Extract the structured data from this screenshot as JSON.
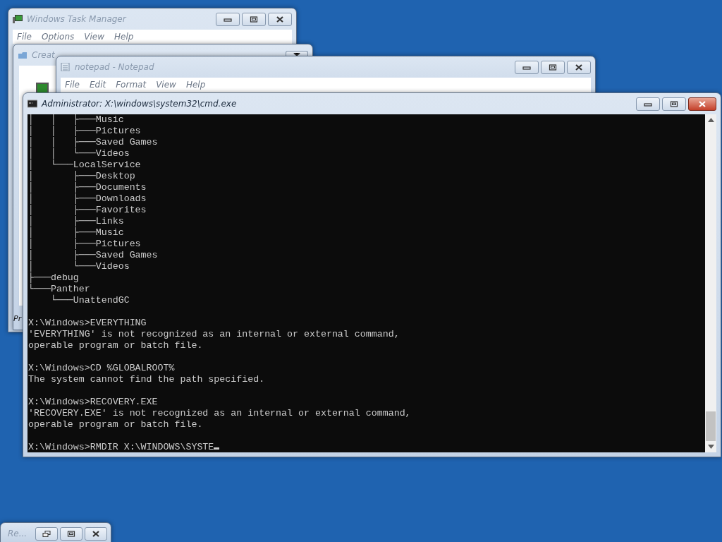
{
  "windows": [
    {
      "kind": "task_manager",
      "title": "Windows Task Manager",
      "active": false,
      "menu": [
        "File",
        "Options",
        "View",
        "Help"
      ]
    },
    {
      "kind": "dialog",
      "title": "Creat",
      "active": false,
      "footer_text": "Pr"
    },
    {
      "kind": "notepad",
      "title": "notepad - Notepad",
      "active": false,
      "menu": [
        "File",
        "Edit",
        "Format",
        "View",
        "Help"
      ]
    },
    {
      "kind": "console",
      "title": "Administrator: X:\\windows\\system32\\cmd.exe",
      "active": true,
      "blocks": [
        [
          "│   │   ├───Music",
          "│   │   ├───Pictures",
          "│   │   ├───Saved Games",
          "│   │   └───Videos",
          "│   └───LocalService",
          "│       ├───Desktop",
          "│       ├───Documents",
          "│       ├───Downloads",
          "│       ├───Favorites",
          "│       ├───Links",
          "│       ├───Music",
          "│       ├───Pictures",
          "│       ├───Saved Games",
          "│       └───Videos",
          "├───debug",
          "└───Panther",
          "    └───UnattendGC"
        ],
        [
          "X:\\Windows>EVERYTHING",
          "'EVERYTHING' is not recognized as an internal or external command,",
          "operable program or batch file."
        ],
        [
          "X:\\Windows>CD %GLOBALROOT%",
          "The system cannot find the path specified."
        ],
        [
          "X:\\Windows>RECOVERY.EXE",
          "'RECOVERY.EXE' is not recognized as an internal or external command,",
          "operable program or batch file."
        ],
        [
          "X:\\Windows>RMDIR X:\\WINDOWS\\SYSTE"
        ]
      ]
    },
    {
      "kind": "minimized",
      "title": "Re...",
      "active": false
    }
  ]
}
